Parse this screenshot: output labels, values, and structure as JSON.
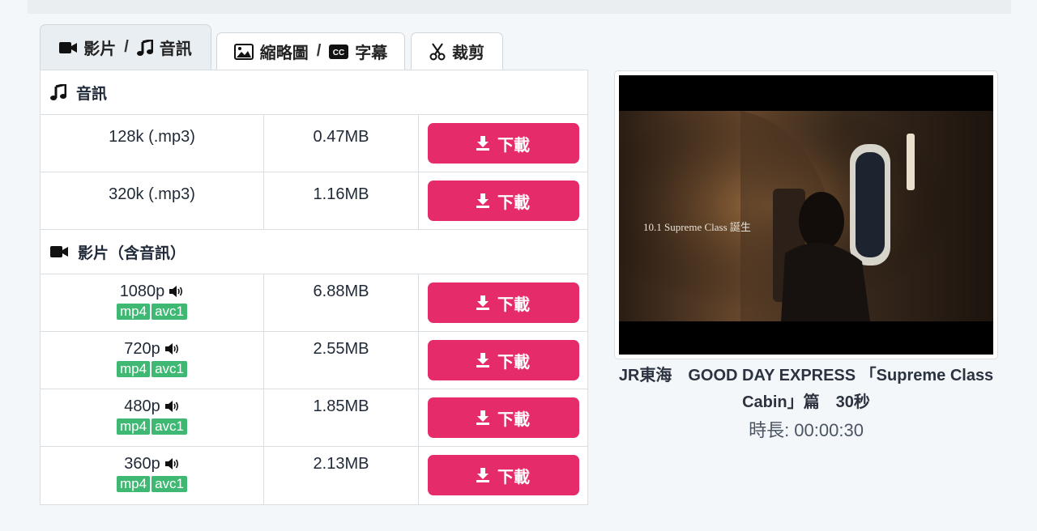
{
  "tabs": [
    {
      "label_a": "影片",
      "sep": "/",
      "label_b": "音訊",
      "active": true
    },
    {
      "label_a": "縮略圖",
      "sep": "/",
      "label_b": "字幕",
      "active": false
    },
    {
      "label_a": "裁剪",
      "active": false
    }
  ],
  "audio_section": {
    "title": "音訊",
    "rows": [
      {
        "quality": "128k (.mp3)",
        "size": "0.47MB",
        "button": "下載"
      },
      {
        "quality": "320k (.mp3)",
        "size": "1.16MB",
        "button": "下載"
      }
    ]
  },
  "video_section": {
    "title": "影片（含音訊）",
    "rows": [
      {
        "quality": "1080p",
        "format": "mp4",
        "codec": "avc1",
        "size": "6.88MB",
        "button": "下載"
      },
      {
        "quality": "720p",
        "format": "mp4",
        "codec": "avc1",
        "size": "2.55MB",
        "button": "下載"
      },
      {
        "quality": "480p",
        "format": "mp4",
        "codec": "avc1",
        "size": "1.85MB",
        "button": "下載"
      },
      {
        "quality": "360p",
        "format": "mp4",
        "codec": "avc1",
        "size": "2.13MB",
        "button": "下載"
      }
    ]
  },
  "video": {
    "thumbnail_caption": "10.1 Supreme Class 誕生",
    "title": "JR東海　GOOD DAY EXPRESS 「Supreme Class Cabin」篇　30秒",
    "duration": "時長: 00:00:30"
  },
  "colors": {
    "accent": "#e62b6a",
    "badge": "#3fb873"
  }
}
